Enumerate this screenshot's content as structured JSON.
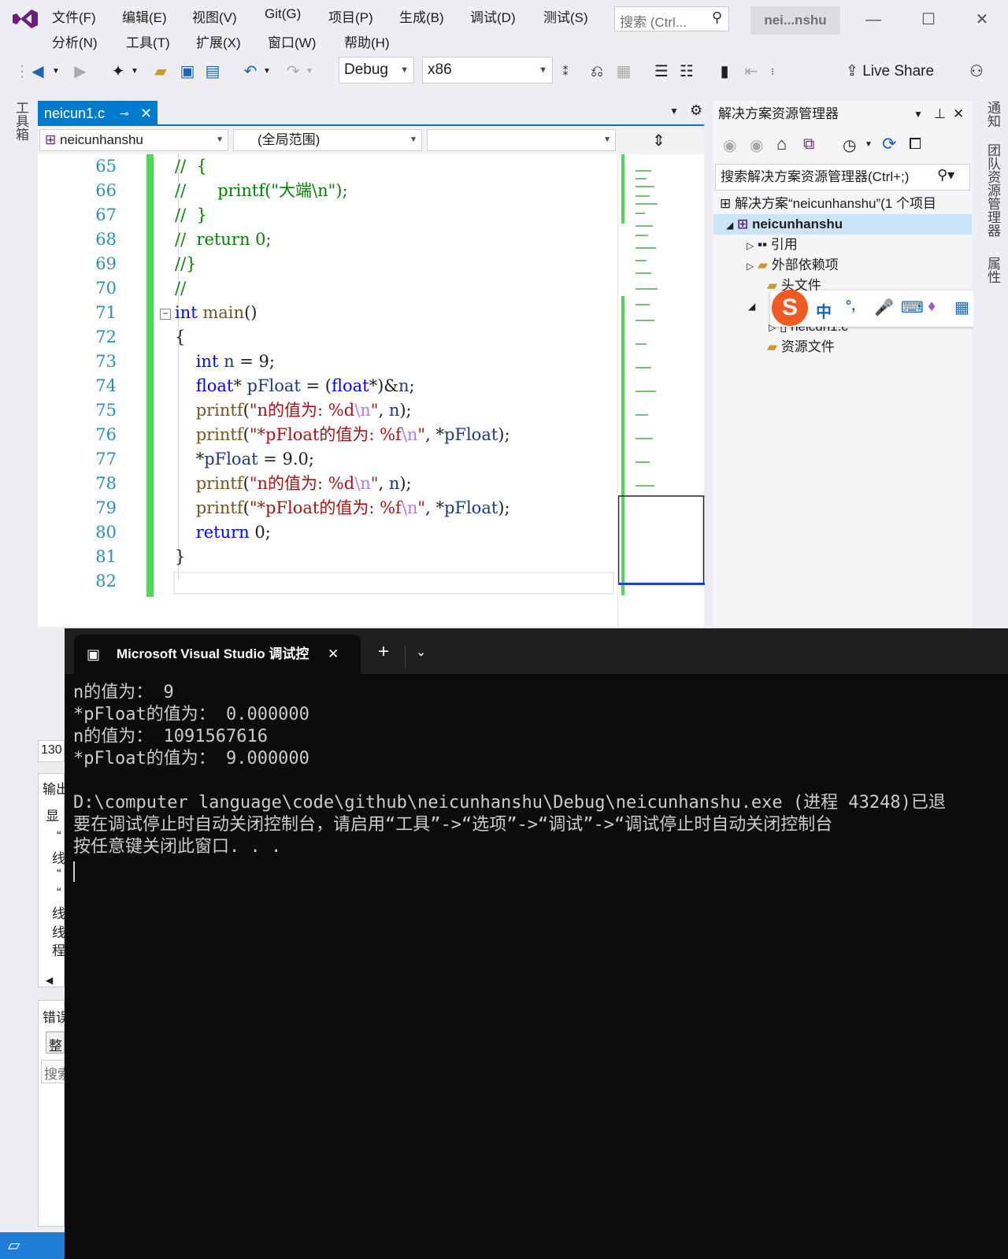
{
  "menu": {
    "row1": [
      "文件(F)",
      "编辑(E)",
      "视图(V)",
      "Git(G)",
      "项目(P)",
      "生成(B)",
      "调试(D)",
      "测试(S)"
    ],
    "row2": [
      "分析(N)",
      "工具(T)",
      "扩展(X)",
      "窗口(W)",
      "帮助(H)"
    ],
    "search_placeholder": "搜索 (Ctrl...",
    "project_tag": "nei...nshu"
  },
  "toolbar": {
    "config": "Debug",
    "platform": "x86",
    "live_share": "Live Share"
  },
  "left_strip": {
    "toolbox": "工具箱"
  },
  "editor": {
    "tab": "neicun1.c",
    "nav_project": "neicunhanshu",
    "nav_scope": "(全局范围)",
    "nav_member": "",
    "line_numbers": [
      "65",
      "66",
      "67",
      "68",
      "69",
      "70",
      "71",
      "72",
      "73",
      "74",
      "75",
      "76",
      "77",
      "78",
      "79",
      "80",
      "81",
      "82"
    ]
  },
  "solution_explorer": {
    "title": "解决方案资源管理器",
    "search": "搜索解决方案资源管理器(Ctrl+;)",
    "solution": "解决方案“neicunhanshu”(1 个项目",
    "project": "neicunhanshu",
    "items": [
      "引用",
      "外部依赖项",
      "头文件",
      "neicun1.c",
      "资源文件"
    ]
  },
  "right_strip": [
    "通知",
    "团队资源管理器",
    "属性"
  ],
  "ime": {
    "lang": "中",
    "punct": "°,"
  },
  "bottom_left": {
    "line_indicator": "130",
    "output_title": "输出",
    "show_label": "显",
    "output_chars": [
      "“",
      "线",
      "“",
      "“",
      "线",
      "线",
      "程"
    ],
    "error_title": "错误",
    "scope_label": "整",
    "search_label": "搜索"
  },
  "console": {
    "tab_title": "Microsoft Visual Studio 调试控",
    "lines": [
      "n的值为： 9",
      "*pFloat的值为： 0.000000",
      "n的值为： 1091567616",
      "*pFloat的值为： 9.000000",
      "",
      "D:\\computer language\\code\\github\\neicunhanshu\\Debug\\neicunhanshu.exe (进程 43248)已退",
      "要在调试停止时自动关闭控制台，请启用“工具”->“选项”->“调试”->“调试停止时自动关闭控制台",
      "按任意键关闭此窗口. . ."
    ]
  },
  "colors": {
    "accent": "#007acc",
    "keyword": "#0000ff",
    "string": "#a31515",
    "comment": "#008000",
    "console_bg": "#0c0c0c"
  }
}
